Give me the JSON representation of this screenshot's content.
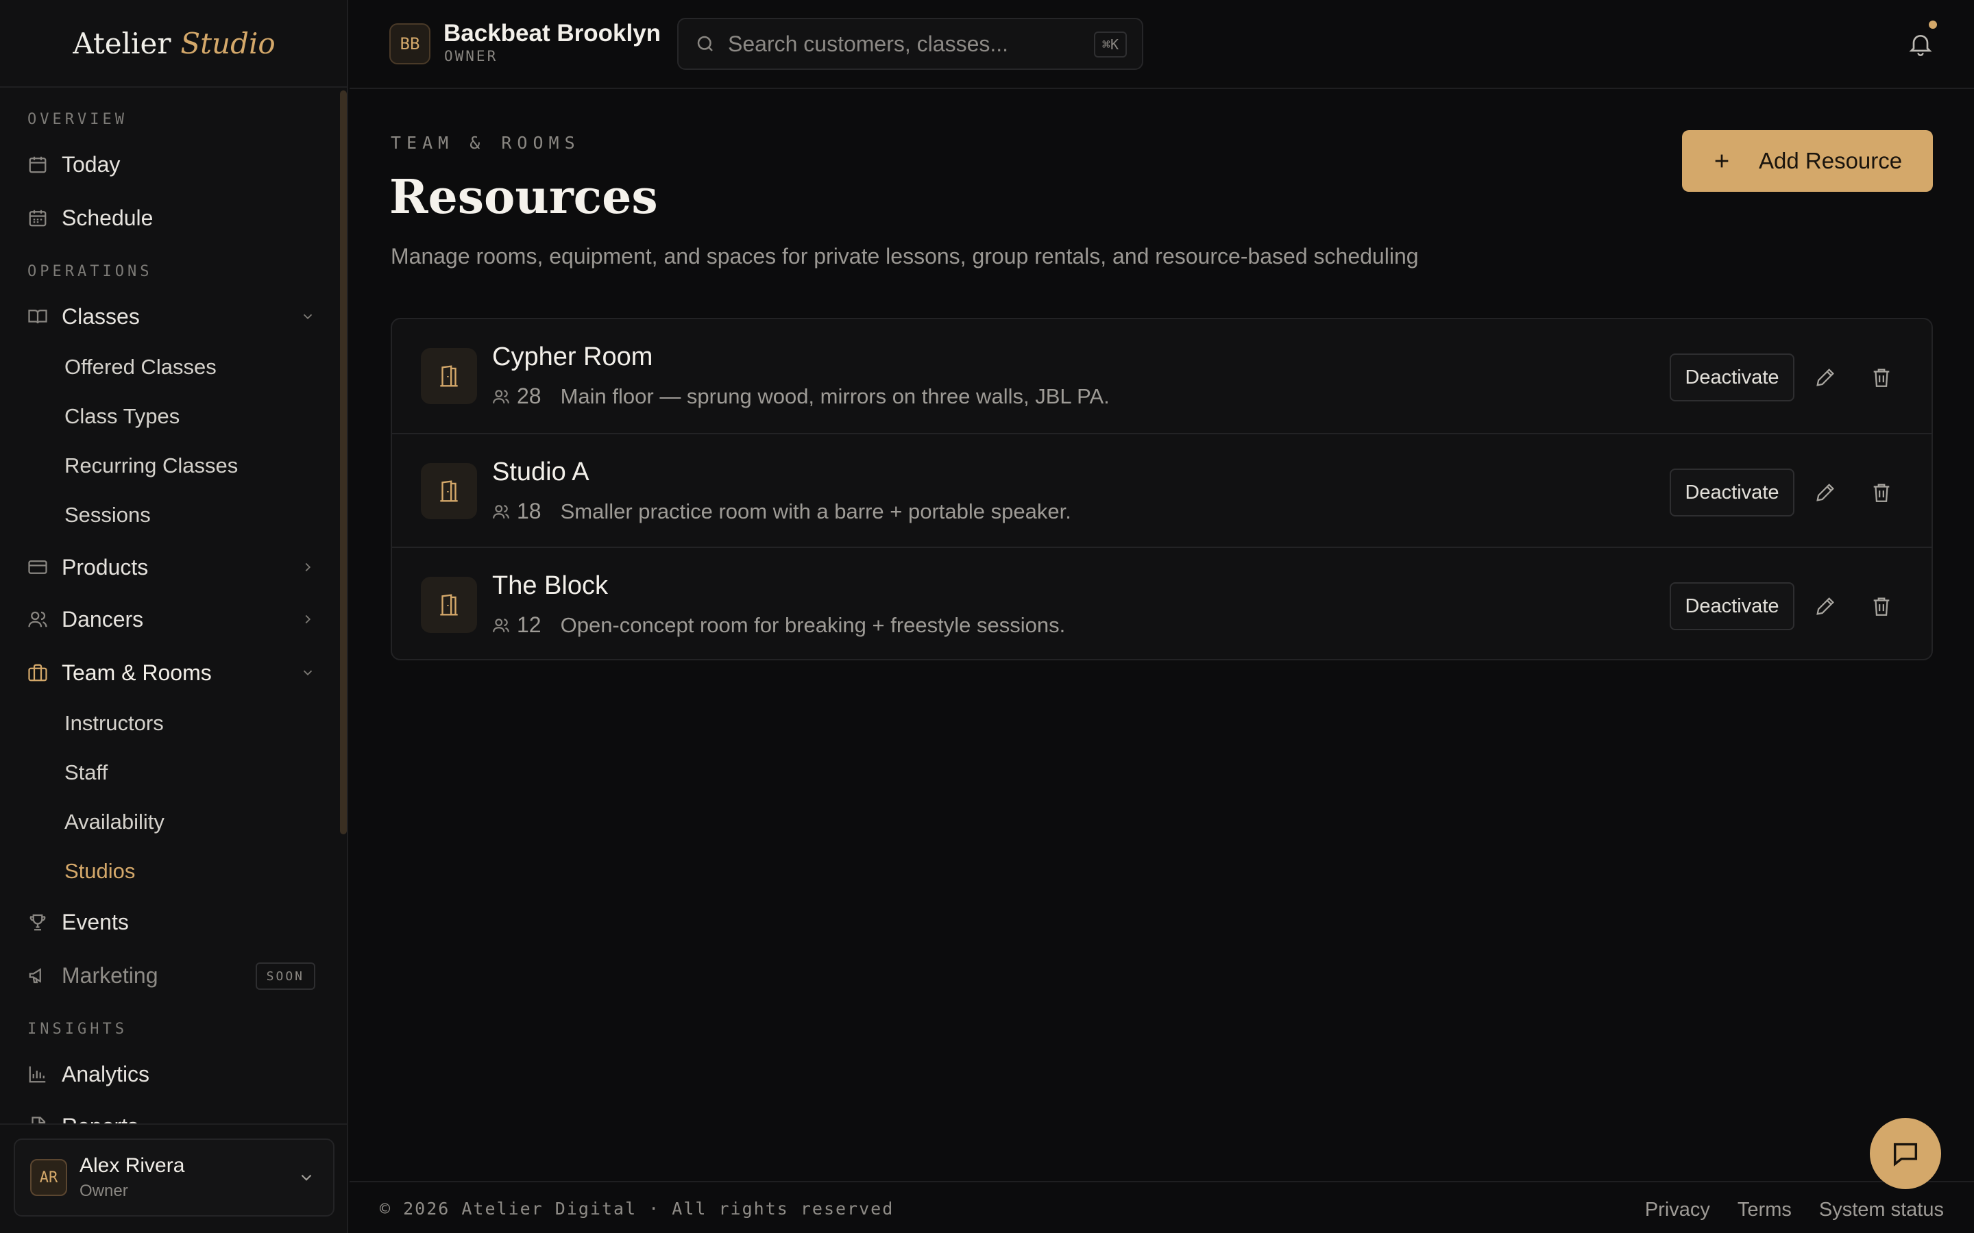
{
  "app": {
    "logo_main": "Atelier",
    "logo_accent": "Studio"
  },
  "header": {
    "business_initials": "BB",
    "business_name": "Backbeat Brooklyn",
    "business_role": "OWNER",
    "search_placeholder": "Search customers, classes...",
    "search_shortcut": "⌘K",
    "has_notifications": true
  },
  "sidebar": {
    "sections": {
      "overview": "OVERVIEW",
      "operations": "OPERATIONS",
      "insights": "INSIGHTS"
    },
    "items": {
      "today": "Today",
      "schedule": "Schedule",
      "classes": "Classes",
      "products": "Products",
      "dancers": "Dancers",
      "team_rooms": "Team & Rooms",
      "events": "Events",
      "marketing": "Marketing",
      "marketing_badge": "SOON",
      "analytics": "Analytics",
      "reports": "Reports"
    },
    "classes_sub": [
      "Offered Classes",
      "Class Types",
      "Recurring Classes",
      "Sessions"
    ],
    "team_sub": [
      "Instructors",
      "Staff",
      "Availability",
      "Studios"
    ],
    "user": {
      "initials": "AR",
      "name": "Alex Rivera",
      "role": "Owner"
    }
  },
  "main": {
    "eyebrow": "TEAM & ROOMS",
    "title": "Resources",
    "description": "Manage rooms, equipment, and spaces for private lessons, group rentals, and resource-based scheduling",
    "add_button": "Add Resource",
    "resources": [
      {
        "name": "Cypher Room",
        "capacity": "28",
        "description": "Main floor — sprung wood, mirrors on three walls, JBL PA.",
        "action": "Deactivate"
      },
      {
        "name": "Studio A",
        "capacity": "18",
        "description": "Smaller practice room with a barre + portable speaker.",
        "action": "Deactivate"
      },
      {
        "name": "The Block",
        "capacity": "12",
        "description": "Open-concept room for breaking + freestyle sessions.",
        "action": "Deactivate"
      }
    ]
  },
  "footer": {
    "copyright": "© 2026 Atelier Digital · All rights reserved",
    "links": [
      "Privacy",
      "Terms",
      "System status"
    ]
  },
  "colors": {
    "accent": "#d4a86a",
    "background": "#0c0c0d",
    "sidebar": "#111112"
  }
}
